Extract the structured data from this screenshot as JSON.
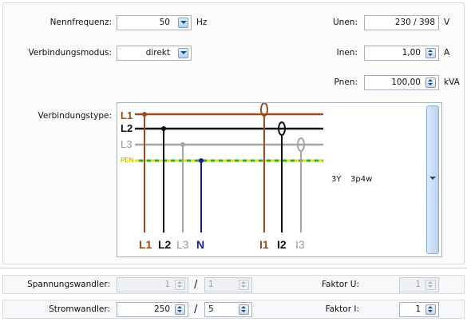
{
  "frequency": {
    "label": "Nennfrequenz:",
    "value": "50",
    "unit": "Hz"
  },
  "connection_mode": {
    "label": "Verbindungsmodus:",
    "value": "direkt"
  },
  "unen": {
    "label": "Unen:",
    "value": "230 / 398",
    "unit": "V"
  },
  "inen": {
    "label": "Inen:",
    "value": "1,00",
    "unit": "A"
  },
  "pnen": {
    "label": "Pnen:",
    "value": "100,00",
    "unit": "kVA"
  },
  "connection_type": {
    "label": "Verbindungstype:",
    "lines": [
      "L1",
      "L2",
      "L3",
      "PEN"
    ],
    "bottom_labels": [
      "L1",
      "L2",
      "L3",
      "N",
      "I1",
      "I2",
      "I3"
    ],
    "caption_a": "3Y",
    "caption_b": "3p4w",
    "colors": {
      "L1": "#9a4a1c",
      "L2": "#111111",
      "L3": "#a6a6a6",
      "N": "#1a1aa0",
      "PEN_yellow": "#e8e000",
      "PEN_green": "#3aa63a"
    }
  },
  "voltage_transformer": {
    "label": "Spannungswandler:",
    "primary": "1",
    "secondary": "1",
    "factor_label": "Faktor U:",
    "factor": "1"
  },
  "current_transformer": {
    "label": "Stromwandler:",
    "primary": "250",
    "secondary": "5",
    "factor_label": "Faktor I:",
    "factor": "1"
  }
}
